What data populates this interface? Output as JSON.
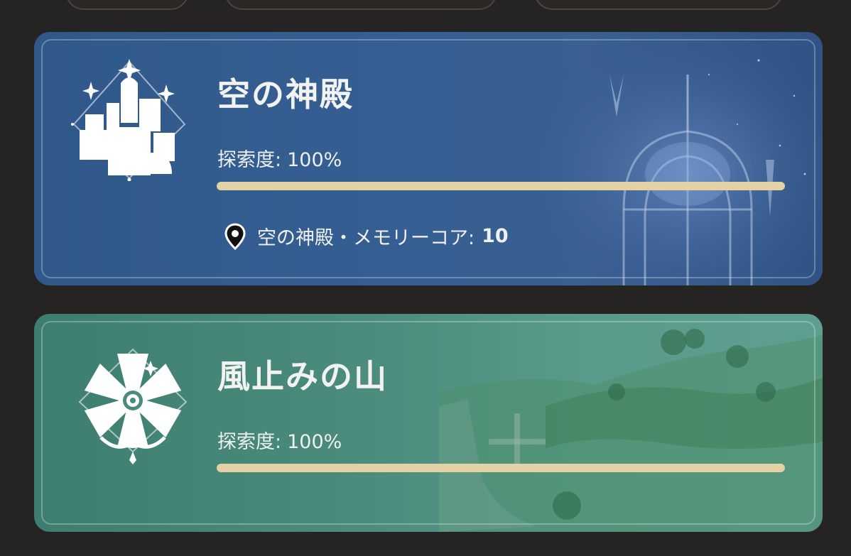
{
  "colors": {
    "page_bg": "#262422",
    "sky_card": "#355f93",
    "wind_card": "#4a8b7d",
    "progress_fill": "#e2d2a6"
  },
  "regions": [
    {
      "name": "空の神殿",
      "icon": "sky-temple-emblem-icon",
      "progress_label": "探索度:",
      "progress_value": "100%",
      "progress_fraction": 1.0,
      "memory": {
        "icon": "location-pin-icon",
        "label": "空の神殿・メモリーコア:",
        "count": "10"
      }
    },
    {
      "name": "風止みの山",
      "icon": "windmill-emblem-icon",
      "progress_label": "探索度:",
      "progress_value": "100%",
      "progress_fraction": 1.0
    }
  ]
}
